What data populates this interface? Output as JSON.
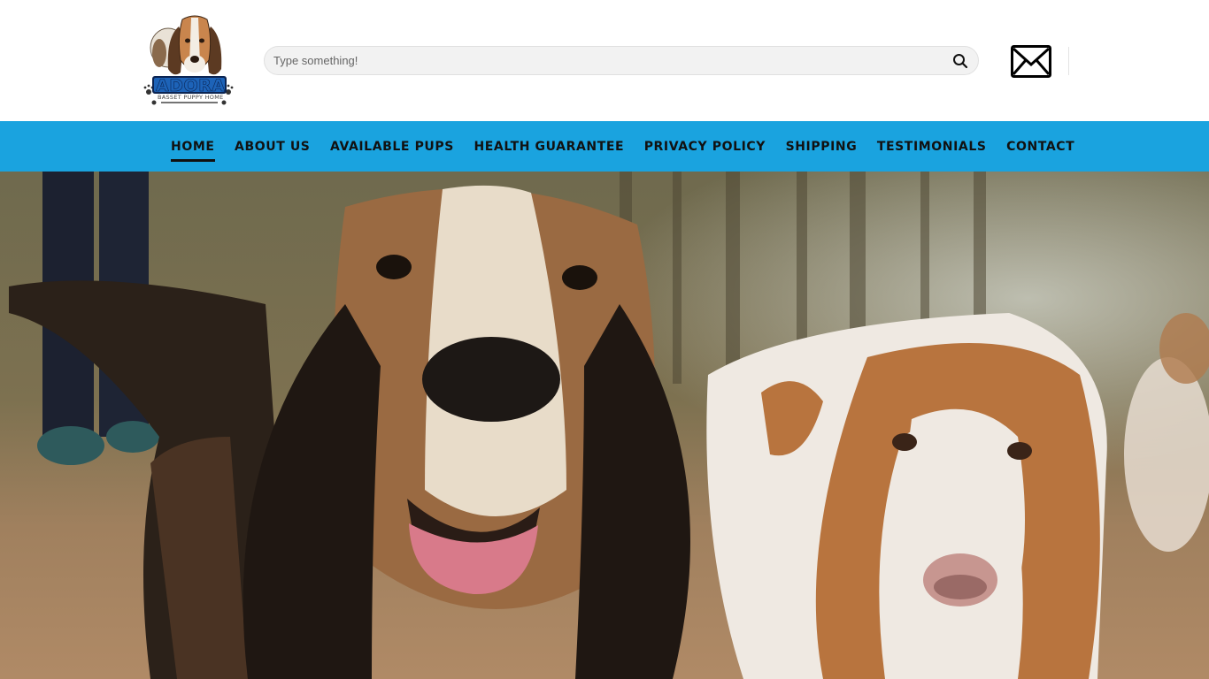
{
  "brand": {
    "name": "ADORA",
    "tagline": "BASSET PUPPY HOME",
    "logo_icon": "basset-hound-logo"
  },
  "search": {
    "placeholder": "Type something!",
    "icon": "search-icon"
  },
  "contact": {
    "icon": "envelope-icon"
  },
  "nav": {
    "items": [
      {
        "label": "HOME",
        "active": true
      },
      {
        "label": "ABOUT US"
      },
      {
        "label": "AVAILABLE PUPS"
      },
      {
        "label": "HEALTH GUARANTEE"
      },
      {
        "label": "PRIVACY POLICY"
      },
      {
        "label": "SHIPPING"
      },
      {
        "label": "TESTIMONIALS"
      },
      {
        "label": "CONTACT"
      }
    ]
  },
  "colors": {
    "nav_bg": "#1aa3df",
    "nav_text": "#111111",
    "logo_blue": "#1d63b8"
  },
  "hero": {
    "image_subject": "two basset hounds outdoors"
  }
}
